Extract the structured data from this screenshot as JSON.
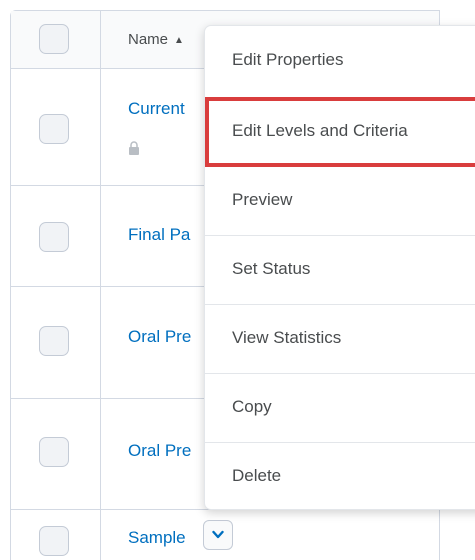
{
  "table": {
    "header": {
      "name_label": "Name",
      "sort_icon": "sort-ascending-icon"
    },
    "rows": [
      {
        "name": "Current"
      },
      {
        "name": "Final Pa"
      },
      {
        "name": "Oral Pre"
      },
      {
        "name": "Oral Pre"
      },
      {
        "name": "Sample"
      }
    ]
  },
  "menu": {
    "items": [
      {
        "label": "Edit Properties"
      },
      {
        "label": "Edit Levels and Criteria",
        "highlighted": true
      },
      {
        "label": "Preview"
      },
      {
        "label": "Set Status"
      },
      {
        "label": "View Statistics"
      },
      {
        "label": "Copy"
      },
      {
        "label": "Delete"
      }
    ]
  },
  "colors": {
    "link": "#006fbf",
    "text": "#494c4e",
    "border": "#d3d9e3",
    "highlight": "#d93d3d"
  }
}
